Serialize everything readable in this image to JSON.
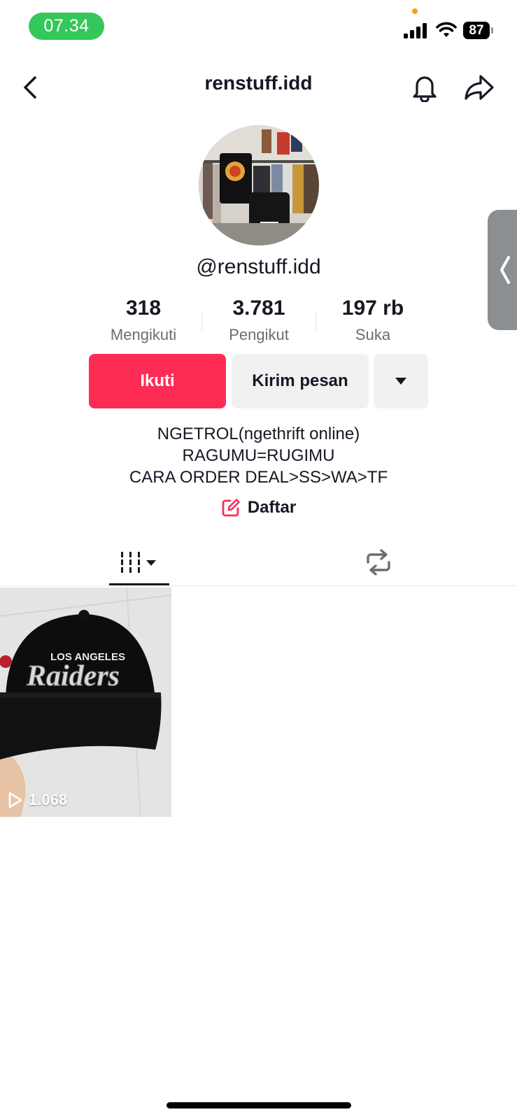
{
  "status_bar": {
    "time": "07.34",
    "battery": "87",
    "icons": [
      "signal-icon",
      "wifi-icon",
      "battery-icon"
    ]
  },
  "header": {
    "title": "renstuff.idd",
    "icons": [
      "back-chevron-icon",
      "bell-icon",
      "share-arrow-icon"
    ]
  },
  "profile": {
    "handle": "@renstuff.idd",
    "stats": [
      {
        "value": "318",
        "label": "Mengikuti"
      },
      {
        "value": "3.781",
        "label": "Pengikut"
      },
      {
        "value": "197 rb",
        "label": "Suka"
      }
    ],
    "buttons": {
      "follow": "Ikuti",
      "message": "Kirim pesan"
    },
    "bio_lines": [
      "NGETROL(ngethrift online)",
      "RAGUMU=RUGIMU",
      "CARA ORDER DEAL>SS>WA>TF"
    ],
    "link_label": "Daftar"
  },
  "tabs": {
    "icons": [
      "grid-icon",
      "repost-icon"
    ],
    "active": 0
  },
  "videos": [
    {
      "views": "1.068",
      "cap_text_top": "LOS ANGELES",
      "cap_text_script": "Raiders"
    }
  ],
  "colors": {
    "accent": "#fe2c55",
    "status_green": "#34c759",
    "secondary_button": "#f1f1f2",
    "muted_text": "#6b6d73"
  }
}
